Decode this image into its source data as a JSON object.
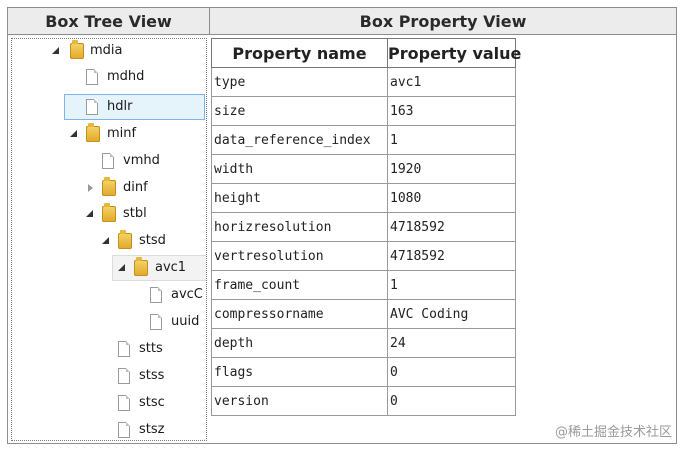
{
  "headers": {
    "tree_title": "Box Tree View",
    "property_title": "Box Property View"
  },
  "tree": {
    "selected": "hdlr",
    "nodes": [
      {
        "label": "mdia",
        "kind": "folder",
        "expander": "open"
      },
      {
        "label": "mdhd",
        "kind": "file"
      },
      {
        "label": "hdlr",
        "kind": "file",
        "selected": true
      },
      {
        "label": "minf",
        "kind": "folder",
        "expander": "open"
      },
      {
        "label": "vmhd",
        "kind": "file"
      },
      {
        "label": "dinf",
        "kind": "folder",
        "expander": "closed"
      },
      {
        "label": "stbl",
        "kind": "folder",
        "expander": "open"
      },
      {
        "label": "stsd",
        "kind": "folder",
        "expander": "open"
      },
      {
        "label": "avc1",
        "kind": "folder",
        "expander": "open"
      },
      {
        "label": "avcC",
        "kind": "file"
      },
      {
        "label": "uuid",
        "kind": "file"
      },
      {
        "label": "stts",
        "kind": "file"
      },
      {
        "label": "stss",
        "kind": "file"
      },
      {
        "label": "stsc",
        "kind": "file"
      },
      {
        "label": "stsz",
        "kind": "file"
      }
    ]
  },
  "properties": {
    "columns": {
      "name": "Property name",
      "value": "Property value"
    },
    "rows": [
      {
        "name": "type",
        "value": "avc1"
      },
      {
        "name": "size",
        "value": "163"
      },
      {
        "name": "data_reference_index",
        "value": "1"
      },
      {
        "name": "width",
        "value": "1920"
      },
      {
        "name": "height",
        "value": "1080"
      },
      {
        "name": "horizresolution",
        "value": "4718592"
      },
      {
        "name": "vertresolution",
        "value": "4718592"
      },
      {
        "name": "frame_count",
        "value": "1"
      },
      {
        "name": "compressorname",
        "value": "AVC Coding"
      },
      {
        "name": "depth",
        "value": "24"
      },
      {
        "name": "flags",
        "value": "0"
      },
      {
        "name": "version",
        "value": "0"
      }
    ]
  },
  "watermark": "@稀土掘金技术社区"
}
